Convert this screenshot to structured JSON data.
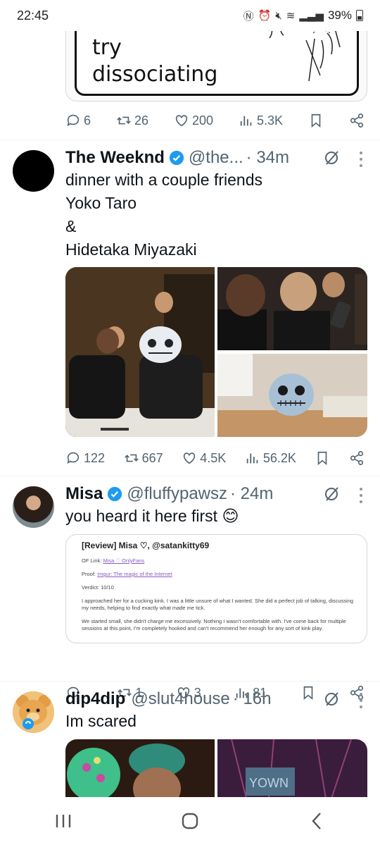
{
  "status": {
    "time": "22:45",
    "battery": "39%"
  },
  "meme": {
    "text": "try\ndissociating"
  },
  "top_actions": {
    "replies": "6",
    "reposts": "26",
    "likes": "200",
    "views": "5.3K"
  },
  "tweets": [
    {
      "name": "The Weeknd",
      "handle": "@the...",
      "time": "· 34m",
      "text": "dinner with a couple friends\nYoko Taro\n&\nHidetaka Miyazaki",
      "actions": {
        "replies": "122",
        "reposts": "667",
        "likes": "4.5K",
        "views": "56.2K"
      }
    },
    {
      "name": "Misa",
      "handle": "@fluffypawsz",
      "time": "· 24m",
      "text": "you heard it here first 😊",
      "card": {
        "title": "[Review] Misa ♡, @satankitty69",
        "of_label": "OF Link: ",
        "of_link": "Misa ♡ OnlyFans",
        "proof_label": "Proof: ",
        "proof_link": "Imgur: The magic of the Internet",
        "verdict": "Verdict: 10/10",
        "para1": "I approached her for a cucking kink. I was a little unsure of what I wanted. She did a perfect job of talking, discussing my needs, helping to find exactly what made me tick.",
        "para2": "We started small, she didn't charge me excessively. Nothing I wasn't comfortable with. I've come back for multiple sessions at this point, I'm completely hooked and can't recommend her enough for any sort of kink play."
      },
      "actions": {
        "replies": "",
        "reposts": "1",
        "likes": "3",
        "views": "81"
      }
    },
    {
      "name": "dip4dip",
      "handle": "@slut4house",
      "time": "· 16h",
      "text": "Im scared"
    }
  ],
  "colors": {
    "verified": "#1d9bf0",
    "icon_gray": "#536471",
    "divider": "#eff3f4"
  }
}
